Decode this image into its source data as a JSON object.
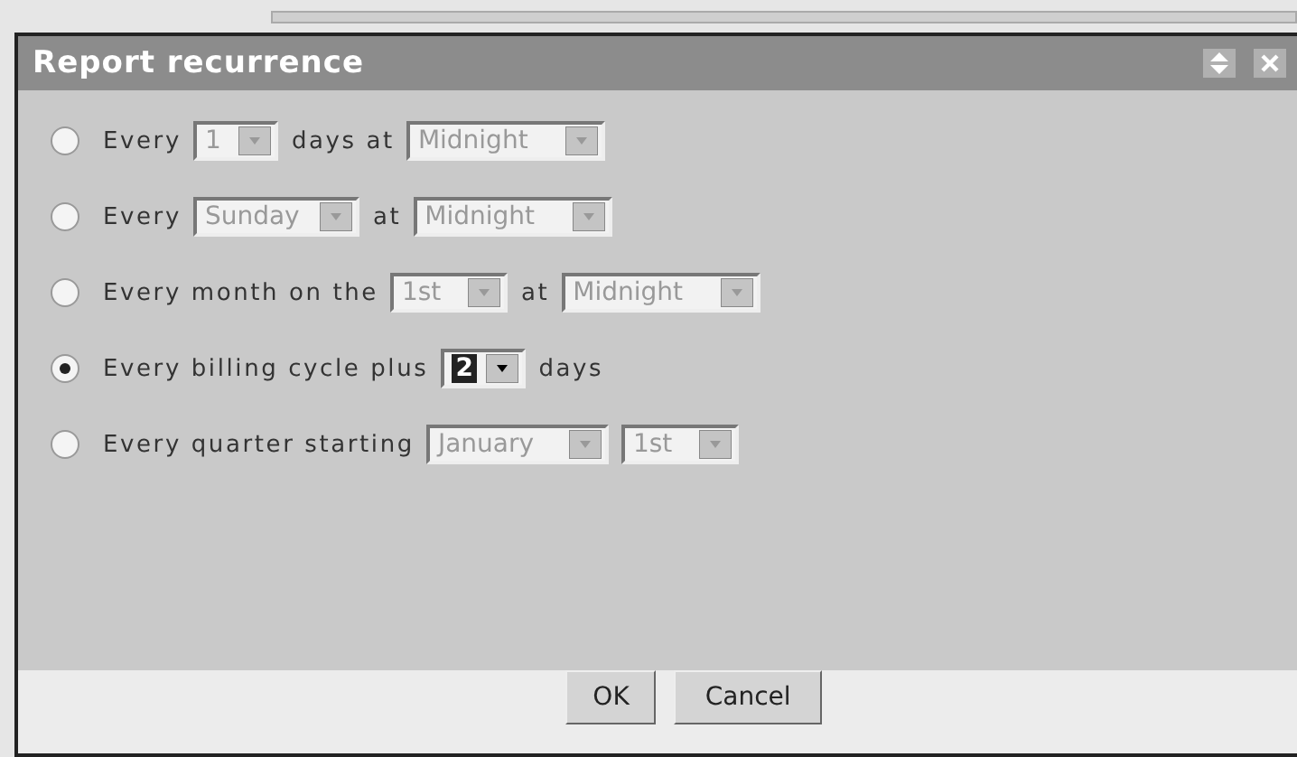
{
  "window": {
    "title": "Report recurrence"
  },
  "options": [
    {
      "selected": false,
      "parts": [
        {
          "kind": "text",
          "text": "Every"
        },
        {
          "kind": "select",
          "value": "1",
          "highlighted": false
        },
        {
          "kind": "text",
          "text": "days at"
        },
        {
          "kind": "select",
          "value": "Midnight",
          "highlighted": false
        }
      ]
    },
    {
      "selected": false,
      "parts": [
        {
          "kind": "text",
          "text": "Every"
        },
        {
          "kind": "select",
          "value": "Sunday",
          "highlighted": false
        },
        {
          "kind": "text",
          "text": "at"
        },
        {
          "kind": "select",
          "value": "Midnight",
          "highlighted": false
        }
      ]
    },
    {
      "selected": false,
      "parts": [
        {
          "kind": "text",
          "text": "Every month on the"
        },
        {
          "kind": "select",
          "value": "1st",
          "highlighted": false
        },
        {
          "kind": "text",
          "text": "at"
        },
        {
          "kind": "select",
          "value": "Midnight",
          "highlighted": false
        }
      ]
    },
    {
      "selected": true,
      "parts": [
        {
          "kind": "text",
          "text": "Every billing cycle plus"
        },
        {
          "kind": "select",
          "value": "2",
          "highlighted": true
        },
        {
          "kind": "text",
          "text": "days"
        }
      ]
    },
    {
      "selected": false,
      "parts": [
        {
          "kind": "text",
          "text": "Every quarter starting"
        },
        {
          "kind": "select",
          "value": "January",
          "highlighted": false
        },
        {
          "kind": "select",
          "value": "1st",
          "highlighted": false
        }
      ]
    }
  ],
  "buttons": [
    "OK",
    "Cancel"
  ]
}
